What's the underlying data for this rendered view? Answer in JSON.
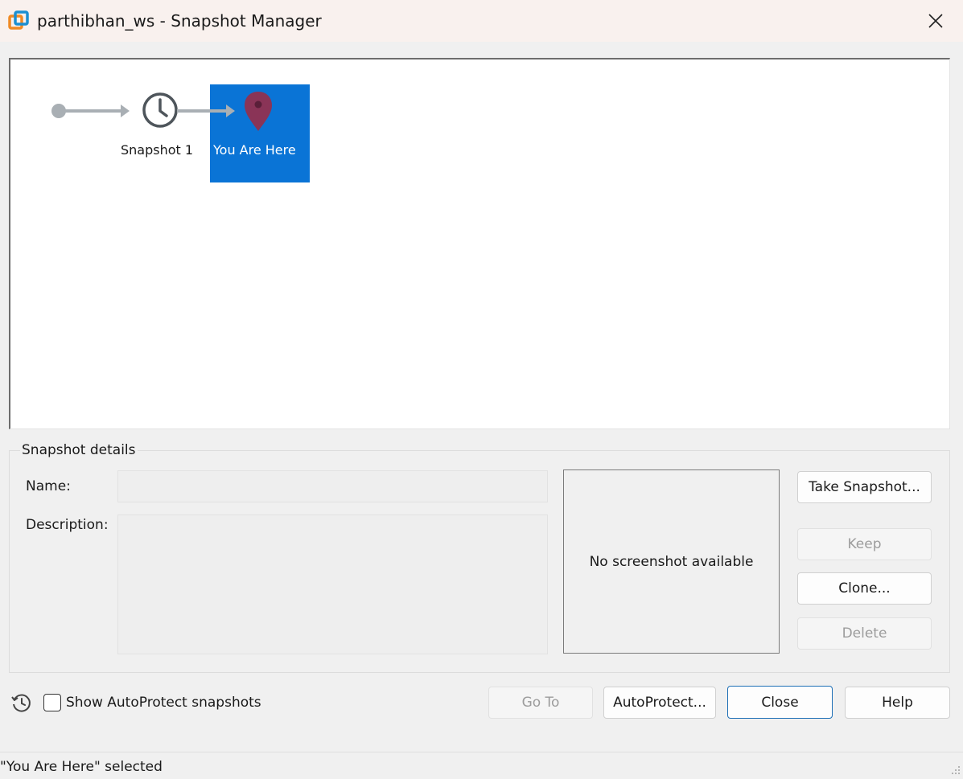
{
  "window": {
    "title": "parthibhan_ws - Snapshot Manager",
    "icon": "vmware-app-icon",
    "close_icon": "close-icon"
  },
  "tree": {
    "nodes": [
      {
        "label": "Snapshot 1",
        "icon": "clock-icon",
        "selected": false
      },
      {
        "label": "You Are Here",
        "icon": "map-pin-icon",
        "selected": true
      }
    ],
    "selected_color": "#0a74d6",
    "pin_color": "#8a3457"
  },
  "details": {
    "legend": "Snapshot details",
    "name_label": "Name:",
    "name_value": "",
    "description_label": "Description:",
    "description_value": "",
    "screenshot_placeholder": "No screenshot available"
  },
  "side_buttons": {
    "take_snapshot": "Take Snapshot...",
    "keep": "Keep",
    "clone": "Clone...",
    "delete": "Delete"
  },
  "footer": {
    "show_autoprotect_label": "Show AutoProtect snapshots",
    "show_autoprotect_checked": false,
    "goto": "Go To",
    "autoprotect": "AutoProtect...",
    "close": "Close",
    "help": "Help"
  },
  "status": {
    "text": "\"You Are Here\" selected"
  }
}
